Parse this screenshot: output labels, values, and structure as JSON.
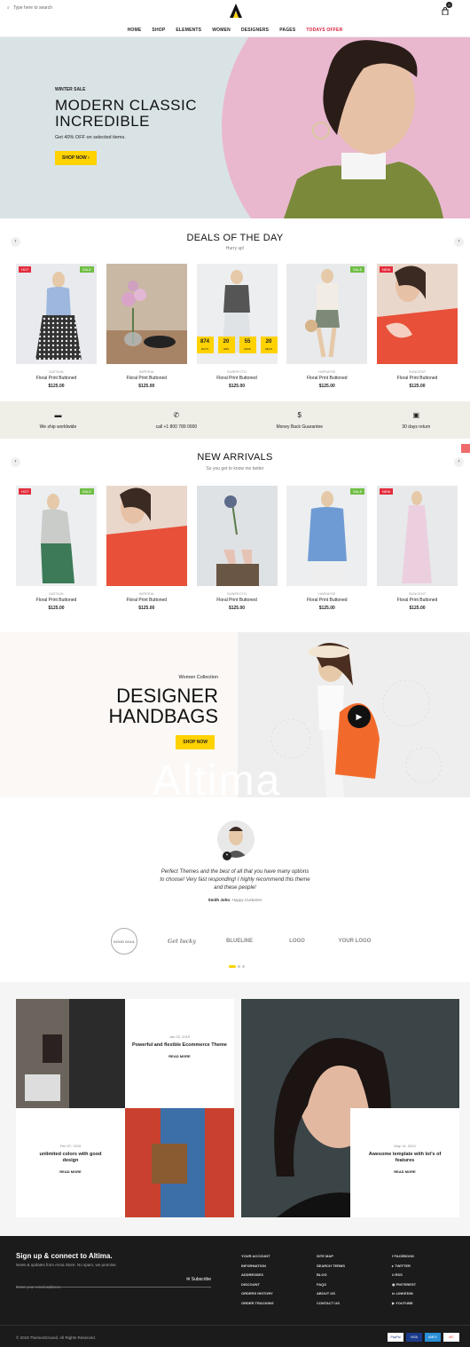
{
  "header": {
    "search_placeholder": "Type here to search",
    "cart_count": "0"
  },
  "nav": [
    "HOME",
    "SHOP",
    "ELEMENTS",
    "WOMEN",
    "DESIGNERS",
    "PAGES",
    "TODAYS OFFER"
  ],
  "hero": {
    "eyebrow": "WINTER SALE",
    "title_line1": "MODERN CLASSIC",
    "title_line2": "INCREDIBLE",
    "subtitle": "Get 40% OFF on selected items.",
    "button": "SHOP NOW ›"
  },
  "deals": {
    "title": "DEALS OF THE DAY",
    "subtitle": "Hurry up!",
    "countdown": [
      {
        "v": "874",
        "l": "DAYS"
      },
      {
        "v": "20",
        "l": "HRS"
      },
      {
        "v": "55",
        "l": "MINS"
      },
      {
        "v": "20",
        "l": "SECS"
      }
    ],
    "products": [
      {
        "brand": "DATSUN",
        "name": "Floral Print Buttoned",
        "price": "$125.00",
        "hot": "HOT",
        "sale": "SALE"
      },
      {
        "brand": "IMPERIA",
        "name": "Floral Print Buttoned",
        "price": "$125.00",
        "hot": "",
        "sale": ""
      },
      {
        "brand": "SUNPECTO",
        "name": "Floral Print Buttoned",
        "price": "$125.00",
        "hot": "",
        "sale": ""
      },
      {
        "brand": "HAPUESE",
        "name": "Floral Print Buttoned",
        "price": "$125.00",
        "hot": "",
        "sale": "SALE"
      },
      {
        "brand": "SUNCENT",
        "name": "Floral Print Buttoned",
        "price": "$125.00",
        "hot": "NEW",
        "sale": ""
      }
    ]
  },
  "services": [
    {
      "icon": "truck-icon",
      "glyph": "🚚",
      "label": "We ship worldwide"
    },
    {
      "icon": "phone-icon",
      "glyph": "✆",
      "label": "call +1 800 789 0000"
    },
    {
      "icon": "dollar-icon",
      "glyph": "$",
      "label": "Money Back Guarantee"
    },
    {
      "icon": "return-icon",
      "glyph": "▣",
      "label": "30 days return"
    }
  ],
  "arrivals": {
    "title": "NEW ARRIVALS",
    "subtitle": "So you get to know me better",
    "products": [
      {
        "brand": "DATSUN",
        "name": "Floral Print Buttoned",
        "price": "$125.00",
        "hot": "HOT",
        "sale": "SALE"
      },
      {
        "brand": "IMPERIA",
        "name": "Floral Print Buttoned",
        "price": "$125.00",
        "hot": "",
        "sale": ""
      },
      {
        "brand": "SUNPECTO",
        "name": "Floral Print Buttoned",
        "price": "$125.00",
        "hot": "",
        "sale": ""
      },
      {
        "brand": "HAPUESE",
        "name": "Floral Print Buttoned",
        "price": "$125.00",
        "hot": "",
        "sale": "SALE"
      },
      {
        "brand": "SUNCENT",
        "name": "Floral Print Buttoned",
        "price": "$125.00",
        "hot": "NEW",
        "sale": ""
      }
    ]
  },
  "banner": {
    "eyebrow": "Women Collection",
    "title1": "DESIGNER",
    "title2": "HANDBAGS",
    "button": "SHOP NOW",
    "watermark": "Altima"
  },
  "testimonial": {
    "quote": "Perfect Themes and the best of all that you have many options to choose! Very fast responding! I highly recommend this theme and these people!",
    "author": "Smith John",
    "role": "Happy Customer"
  },
  "brands": [
    "GOOD SOUL",
    "Get lucky",
    "BLUELINE",
    "LOGO",
    "YOUR LOGO"
  ],
  "blog": [
    {
      "date": "Jan 02, 2019",
      "title": "Powerful and flexible Ecommerce Theme",
      "read": "READ MORE"
    },
    {
      "date": "Feb 07, 2019",
      "title": "unlimited colors with good design",
      "read": "READ MORE"
    },
    {
      "date": "May 14, 2019",
      "title": "Awesome template with lot's of features",
      "read": "READ MORE"
    }
  ],
  "footer": {
    "signup_title": "Sign up & connect to Altima.",
    "signup_text": "News & updates from Anna Store. No spam, we promise.",
    "email_placeholder": "Enter your email address",
    "subscribe": "Subscribe",
    "col1": [
      "YOUR ACCOUNT",
      "INFORMATION",
      "ADDRESSES",
      "DISCOUNT",
      "ORDERS HISTORY",
      "ORDER TRACKING"
    ],
    "col2": [
      "SITE MAP",
      "SEARCH TERMS",
      "BLOG",
      "FAQS",
      "ABOUT US",
      "CONTACT US"
    ],
    "col3": [
      "FACEBOOK",
      "TWITTER",
      "RSS",
      "PINTEREST",
      "LINKEDIN",
      "YOUTUBE"
    ],
    "copyright": "© 2019 ThemesGround. All Rights Reserved.",
    "payments": [
      "PayPal",
      "VISA",
      "AMEX",
      "MC"
    ]
  }
}
